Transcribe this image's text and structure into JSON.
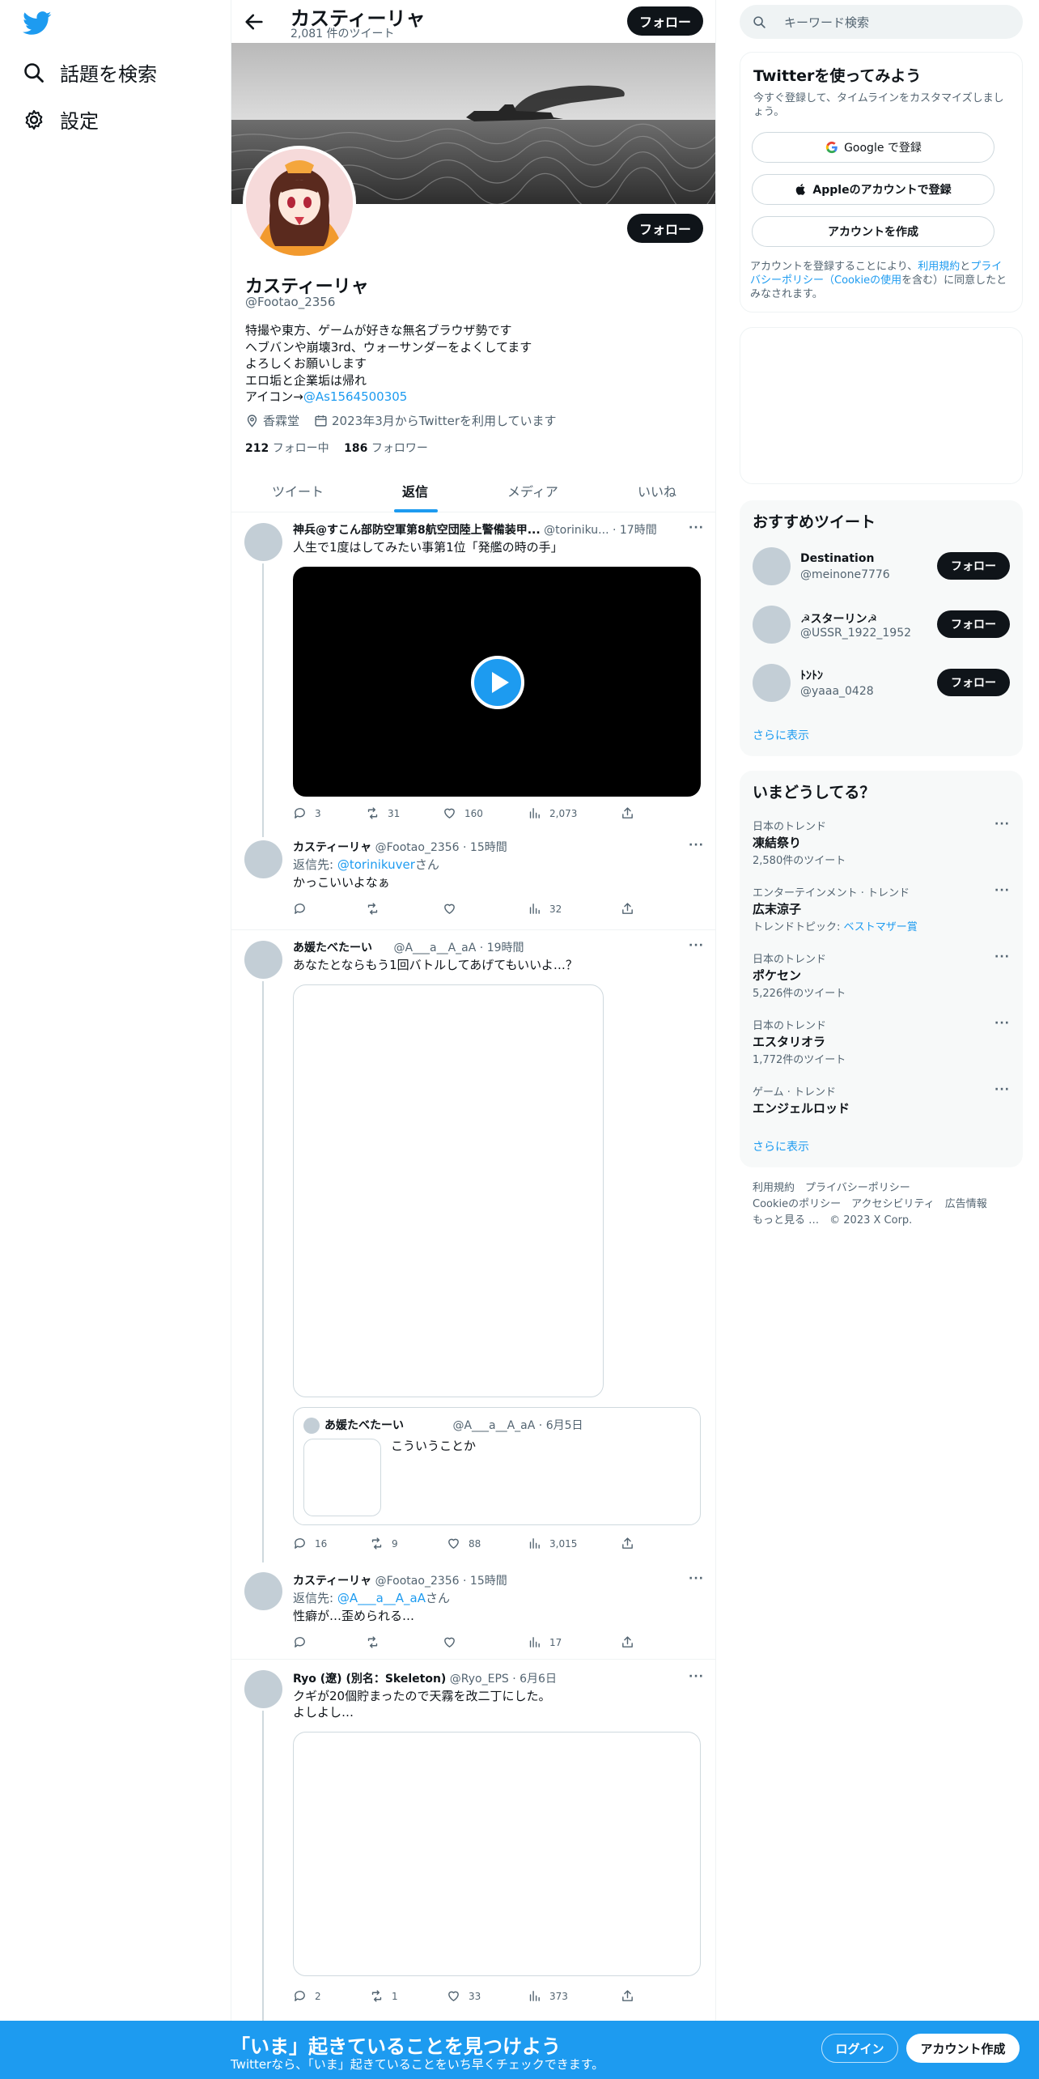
{
  "nav": {
    "explore_label": "話題を検索",
    "settings_label": "設定"
  },
  "header": {
    "name": "カスティーリャ",
    "tweet_count": "2,081 件のツイート",
    "follow_label": "フォロー"
  },
  "profile": {
    "name": "カスティーリャ",
    "handle": "@Footao_2356",
    "follow_label": "フォロー",
    "bio_lines": [
      "特撮や東方、ゲームが好きな無名ブラウザ勢です",
      "ヘブバンや崩壊3rd、ウォーサンダーをよくしてます",
      "よろしくお願いします",
      "エロ垢と企業垢は帰れ"
    ],
    "bio_icon_prefix": "アイコン→",
    "bio_icon_link": "@As1564500305",
    "location": "香霖堂",
    "joined": "2023年3月からTwitterを利用しています",
    "following_count": "212",
    "following_label": "フォロー中",
    "followers_count": "186",
    "followers_label": "フォロワー"
  },
  "tabs": [
    "ツイート",
    "返信",
    "メディア",
    "いいね"
  ],
  "active_tab": "返信",
  "tweets": [
    {
      "name": "神兵@すこん部防空軍第8航空団陸上警備装甲...",
      "handle": "@toriniku...",
      "time": "· 17時間",
      "text": "人生で1度はしてみたい事第1位「発艦の時の手」",
      "replies": "3",
      "retweets": "31",
      "likes": "160",
      "views": "2,073"
    },
    {
      "name": "カスティーリャ",
      "handle": "@Footao_2356",
      "time": "· 15時間",
      "reply_prefix": "返信先: ",
      "reply_to": "@torinikuver",
      "reply_suffix": "さん",
      "text": "かっこいいよなぁ",
      "replies": "",
      "retweets": "",
      "likes": "",
      "views": "32"
    },
    {
      "name": "あ媛たべたーい",
      "handle": "@A___a__A_aA",
      "time": "· 19時間",
      "text": "あなたとならもう1回バトルしてあげてもいいよ…？",
      "quote": {
        "name": "あ媛たべたーい",
        "handle": "@A___a__A_aA",
        "time": "· 6月5日",
        "text": "こういうことか"
      },
      "replies": "16",
      "retweets": "9",
      "likes": "88",
      "views": "3,015"
    },
    {
      "name": "カスティーリャ",
      "handle": "@Footao_2356",
      "time": "· 15時間",
      "reply_prefix": "返信先: ",
      "reply_to": "@A___a__A_aA",
      "reply_suffix": "さん",
      "text": "性癖が…歪められる…",
      "replies": "",
      "retweets": "",
      "likes": "",
      "views": "17"
    },
    {
      "name": "Ryo (遼) (別名：Skeleton)",
      "handle": "@Ryo_EPS",
      "time": "· 6月6日",
      "text_lines": [
        "クギが20個貯まったので天霧を改二丁にした。",
        "よしよし…"
      ],
      "replies": "2",
      "retweets": "1",
      "likes": "33",
      "views": "373"
    }
  ],
  "right": {
    "search_placeholder": "キーワード検索",
    "signup": {
      "title": "Twitterを使ってみよう",
      "subtitle": "今すぐ登録して、タイムラインをカスタマイズしましょう。",
      "google_label": "Google で登録",
      "apple_label": "Appleのアカウントで登録",
      "create_label": "アカウントを作成",
      "legal_prefix": "アカウントを登録することにより、",
      "terms_link": "利用規約",
      "legal_and": "と",
      "privacy_link": "プライバシーポリシー（Cookieの使用",
      "legal_suffix": "を含む）に同意したとみなされます。"
    },
    "recommended": {
      "title": "おすすめツイート",
      "users": [
        {
          "name": "Destination",
          "handle": "@meinone7776"
        },
        {
          "name": "☭スターリン☭",
          "handle": "@USSR_1922_1952"
        },
        {
          "name": "ﾄﾝﾄﾝ",
          "handle": "@yaaa_0428"
        }
      ],
      "follow_label": "フォロー",
      "show_more": "さらに表示"
    },
    "trends": {
      "title": "いまどうしてる？",
      "items": [
        {
          "category": "日本のトレンド",
          "name": "凍結祭り",
          "sub": "2,580件のツイート"
        },
        {
          "category": "エンターテインメント · トレンド",
          "name": "広末涼子",
          "sub_prefix": "トレンドトピック: ",
          "sub_link": "ベストマザー賞"
        },
        {
          "category": "日本のトレンド",
          "name": "ポケセン",
          "sub": "5,226件のツイート"
        },
        {
          "category": "日本のトレンド",
          "name": "エスタリオラ",
          "sub": "1,772件のツイート"
        },
        {
          "category": "ゲーム · トレンド",
          "name": "エンジェルロッド"
        }
      ],
      "show_more": "さらに表示"
    },
    "footer": {
      "links": [
        "利用規約",
        "プライバシーポリシー",
        "Cookieのポリシー",
        "アクセシビリティ",
        "広告情報",
        "もっと見る …"
      ],
      "copyright": "© 2023 X Corp."
    }
  },
  "bottom_bar": {
    "title": "「いま」起きていることを見つけよう",
    "subtitle": "Twitterなら、「いま」起きていることをいち早くチェックできます。",
    "login_label": "ログイン",
    "signup_label": "アカウント作成"
  },
  "colors": {
    "accent": "#1d9bf0",
    "text": "#0f1419",
    "muted": "#536471",
    "border": "#eff3f4"
  }
}
